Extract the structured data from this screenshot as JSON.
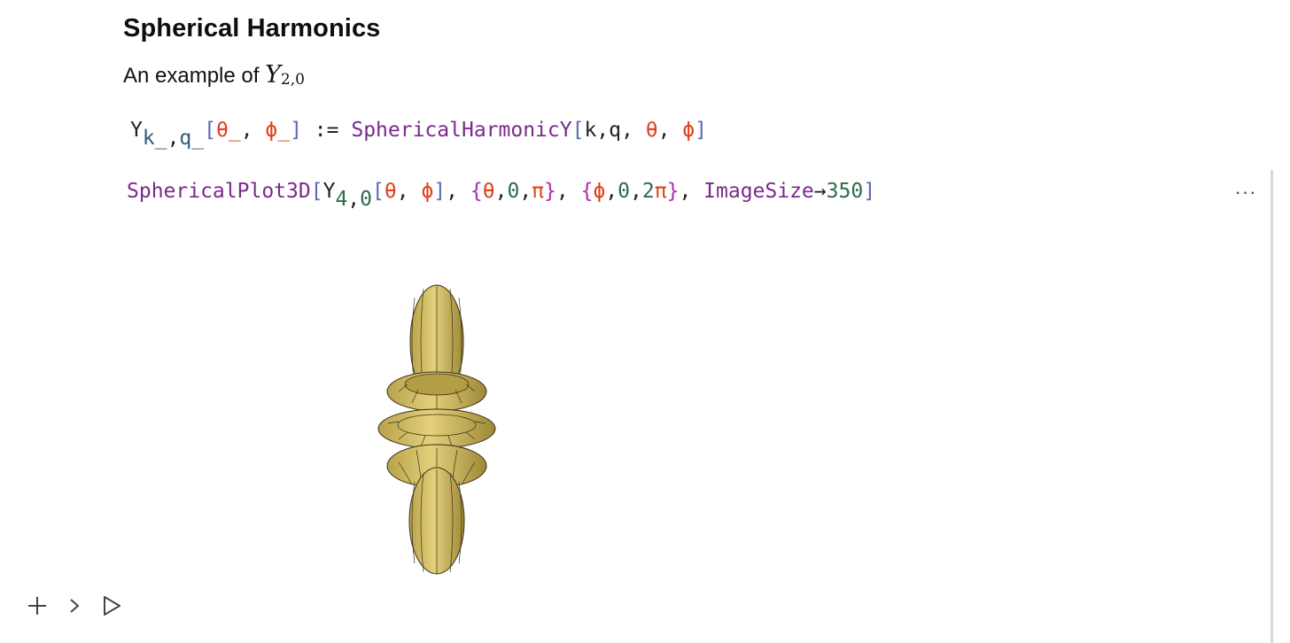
{
  "heading": "Spherical Harmonics",
  "text": {
    "prefix": "An example of ",
    "math_symbol": "Y",
    "math_subscript": "2,0"
  },
  "code_line_1": {
    "head": "Y",
    "sub_k": "k_",
    "sub_comma": ",",
    "sub_q": "q_",
    "open": "[",
    "theta_pat": "θ_",
    "comma_sp": ", ",
    "phi_pat": "ϕ_",
    "close": "]",
    "assign": " := ",
    "fn": "SphericalHarmonicY",
    "fopen": "[",
    "args_kq": "k,q, ",
    "theta": "θ",
    "comma2": ", ",
    "phi": "ϕ",
    "fclose": "]"
  },
  "code_line_2": {
    "fn": "SphericalPlot3D",
    "open": "[",
    "head": "Y",
    "sub_4": "4",
    "sub_comma": ",",
    "sub_0": "0",
    "bopen": "[",
    "theta": "θ",
    "comma": ", ",
    "phi": "ϕ",
    "bclose": "]",
    "sep1": ", ",
    "lb1": "{",
    "r1_var": "θ",
    "r1_c1": ",",
    "r1_lo": "0",
    "r1_c2": ",",
    "r1_hi": "π",
    "rb1": "}",
    "sep2": ", ",
    "lb2": "{",
    "r2_var": "ϕ",
    "r2_c1": ",",
    "r2_lo": "0",
    "r2_c2": ",",
    "r2_hi_num": "2",
    "r2_hi_pi": "π",
    "rb2": "}",
    "sep3": ", ",
    "opt": "ImageSize",
    "arrow": "→",
    "opt_val": "350",
    "close": "]"
  },
  "more_menu": "···",
  "colors": {
    "surface_fill": "#d7c26a",
    "surface_shade": "#9e8a34",
    "mesh": "#3a3218"
  },
  "toolbar": {
    "icons": [
      "plus-icon",
      "chevron-right-icon",
      "play-icon"
    ]
  }
}
